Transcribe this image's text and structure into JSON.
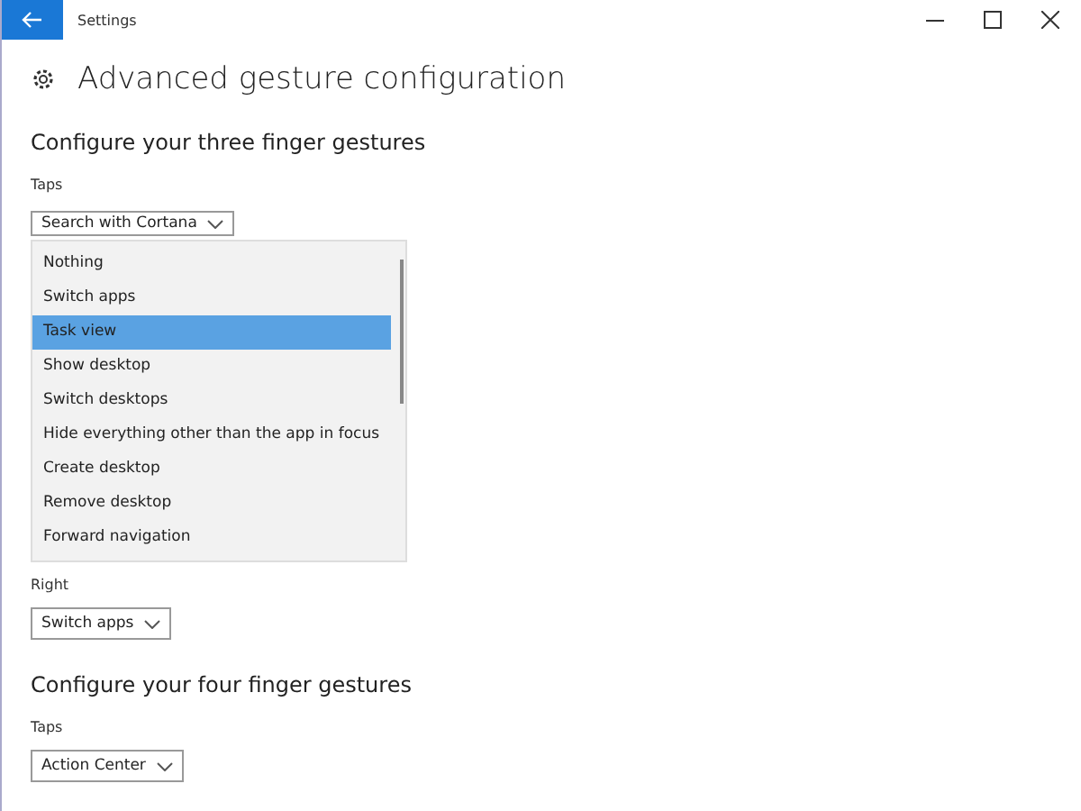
{
  "window": {
    "title": "Settings"
  },
  "page_title": "Advanced gesture configuration",
  "sections": [
    {
      "heading": "Configure your three finger gestures",
      "settings": [
        {
          "label": "Taps",
          "value": "Search with Cortana",
          "options": [
            {
              "label": "Nothing",
              "selected": false
            },
            {
              "label": "Switch apps",
              "selected": false
            },
            {
              "label": "Task view",
              "selected": true
            },
            {
              "label": "Show desktop",
              "selected": false
            },
            {
              "label": "Switch desktops",
              "selected": false
            },
            {
              "label": "Hide everything other than the app in focus",
              "selected": false
            },
            {
              "label": "Create desktop",
              "selected": false
            },
            {
              "label": "Remove desktop",
              "selected": false
            },
            {
              "label": "Forward navigation",
              "selected": false
            }
          ]
        },
        {
          "label": "Right",
          "value": "Switch apps"
        }
      ]
    },
    {
      "heading": "Configure your four finger gestures",
      "settings": [
        {
          "label": "Taps",
          "value": "Action Center"
        }
      ]
    }
  ]
}
